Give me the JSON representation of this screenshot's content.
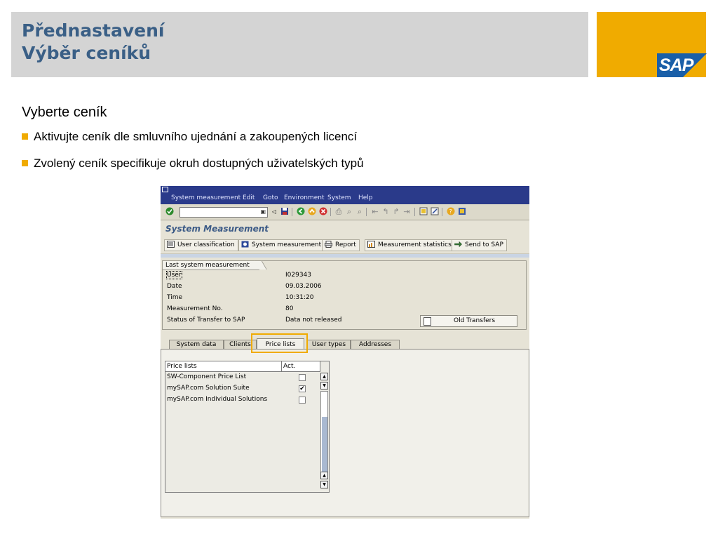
{
  "slide": {
    "title_line1": "Přednastavení",
    "title_line2": "Výběr ceníků",
    "logo_text": "SAP",
    "heading": "Vyberte ceník",
    "bullets": [
      "Aktivujte ceník dle smluvního ujednání a zakoupených licencí",
      "Zvolený ceník specifikuje okruh dostupných uživatelských typů"
    ]
  },
  "sap": {
    "menu": [
      "System measurement",
      "Edit",
      "Goto",
      "Environment",
      "System",
      "Help"
    ],
    "screen_title": "System Measurement",
    "app_buttons": [
      "User classification",
      "System measurement",
      "Report",
      "Measurement statistics",
      "Send to SAP"
    ],
    "frame_title": "Last system measurement",
    "fields": [
      {
        "label": "User",
        "value": "I029343"
      },
      {
        "label": "Date",
        "value": "09.03.2006"
      },
      {
        "label": "Time",
        "value": "10:31:20"
      },
      {
        "label": "Measurement No.",
        "value": "80"
      },
      {
        "label": "Status of Transfer to SAP",
        "value": "Data not released"
      }
    ],
    "old_transfers_button": "Old Transfers",
    "tabs": [
      "System data",
      "Clients",
      "Price lists",
      "User types",
      "Addresses"
    ],
    "active_tab": "Price lists",
    "table": {
      "headers": [
        "Price lists",
        "Act."
      ],
      "rows": [
        {
          "name": "SW-Component Price List",
          "active": false
        },
        {
          "name": "mySAP.com Solution Suite",
          "active": true
        },
        {
          "name": "mySAP.com Individual Solutions",
          "active": false
        }
      ]
    }
  },
  "colors": {
    "accent": "#f0ab00",
    "title_text": "#3a5f86",
    "header_bg": "#d4d4d4",
    "sap_menubar": "#2a3a8a"
  },
  "icons": [
    "sap-logo",
    "enter-check-icon",
    "save-icon",
    "back-icon",
    "exit-icon",
    "cancel-icon",
    "print-icon",
    "find-icon",
    "help-icon",
    "layout-icon",
    "user-classification-icon",
    "system-measurement-icon",
    "report-printer-icon",
    "statistics-icon",
    "send-icon",
    "scroll-up-icon",
    "scroll-down-icon"
  ]
}
